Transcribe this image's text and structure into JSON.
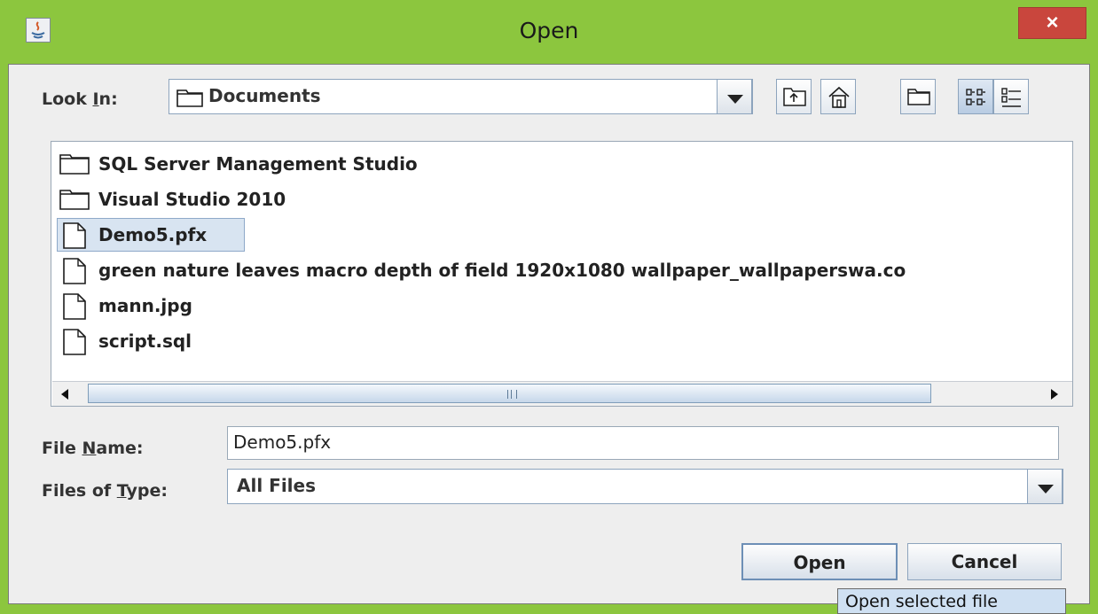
{
  "window": {
    "title": "Open",
    "close_label": "×"
  },
  "look_in": {
    "label_pre": "Look ",
    "label_u": "I",
    "label_post": "n:",
    "value": "Documents"
  },
  "toolbar": {
    "up": "up-one-level-icon",
    "home": "home-icon",
    "new_folder": "new-folder-icon",
    "list_view": "list-view-icon",
    "details_view": "details-view-icon"
  },
  "files": [
    {
      "name": "SQL Server Management Studio",
      "type": "folder"
    },
    {
      "name": "Visual Studio 2010",
      "type": "folder"
    },
    {
      "name": "Demo5.pfx",
      "type": "file",
      "selected": true
    },
    {
      "name": "green nature leaves macro depth of field 1920x1080 wallpaper_wallpaperswa.co",
      "type": "file"
    },
    {
      "name": "mann.jpg",
      "type": "file"
    },
    {
      "name": "script.sql",
      "type": "file"
    }
  ],
  "file_name": {
    "label_pre": "File ",
    "label_u": "N",
    "label_post": "ame:",
    "value": "Demo5.pfx"
  },
  "file_type": {
    "label_pre": "Files of ",
    "label_u": "T",
    "label_post": "ype:",
    "value": "All Files"
  },
  "buttons": {
    "open": "Open",
    "cancel": "Cancel"
  },
  "tooltip": "Open selected file",
  "colors": {
    "frame": "#8cc63e",
    "close": "#c9463d",
    "selection": "#d8e4f1"
  }
}
